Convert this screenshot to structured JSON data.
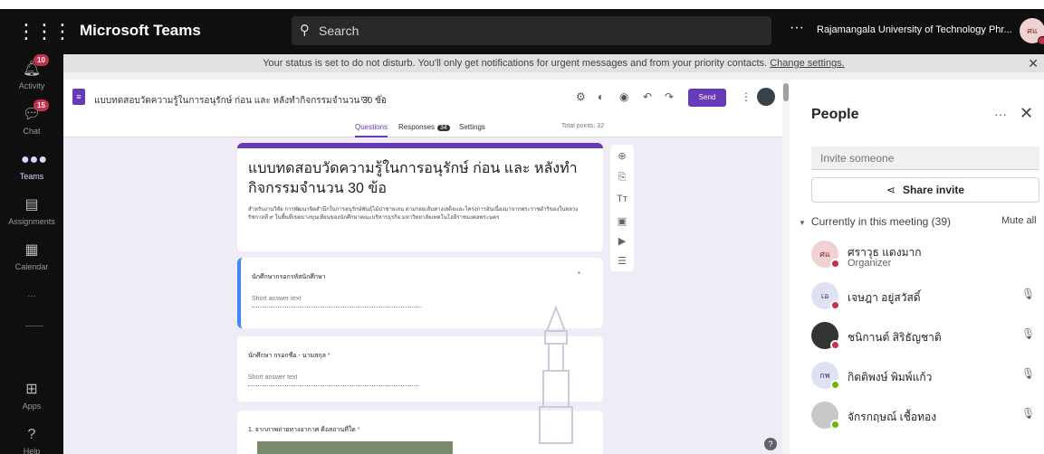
{
  "app": {
    "name": "Microsoft Teams",
    "search_placeholder": "Search",
    "more": "···",
    "org": "Rajamangala University of Technology Phr...",
    "avatar_initials": "ศแ"
  },
  "rail": [
    {
      "label": "Activity",
      "badge": "10",
      "icon": "bell-icon"
    },
    {
      "label": "Chat",
      "badge": "15",
      "icon": "chat-icon"
    },
    {
      "label": "Teams",
      "badge": "",
      "icon": "teams-icon"
    },
    {
      "label": "Assignments",
      "badge": "",
      "icon": "assignments-icon"
    },
    {
      "label": "Calendar",
      "badge": "",
      "icon": "calendar-icon"
    },
    {
      "label": "···",
      "badge": "",
      "icon": "more-icon"
    },
    {
      "label": "Apps",
      "badge": "",
      "icon": "apps-icon"
    },
    {
      "label": "Help",
      "badge": "",
      "icon": "help-icon"
    }
  ],
  "banner": {
    "text": "Your status is set to do not disturb. You'll only get notifications for urgent messages and from your priority contacts.",
    "link": "Change settings."
  },
  "form": {
    "title": "แบบทดสอบวัดความรู้ในการอนุรักษ์ ก่อน และ หลังทำกิจกรรมจำนวน 30 ข้อ",
    "send": "Send",
    "tabs": {
      "questions": "Questions",
      "responses": "Responses",
      "responses_count": "34",
      "settings": "Settings"
    },
    "total_points": "Total points: 32",
    "heading": "แบบทดสอบวัดความรู้ในการอนุรักษ์ ก่อน และ หลังทำกิจกรรมจำนวน 30 ข้อ",
    "description": "สำหรับงานวิจัย การพัฒนาจิตสำนึกในการอนุรักษ์พันธุ์ไม้ป่าชายเลน ตามรอยเส้นทางเสด็จและโครงการอันเนื่องมาจากพระราชดำริของในหลวงรัชกาลที่ ๙ ในพื้นที่เขตบางขุนเทียนของนักศึกษาคณะบริหารธุรกิจ มหาวิทยาลัยเทคโนโลยีราชมงคลพระนคร",
    "questions": [
      {
        "label": "นักศึกษากรอกรหัสนักศึกษา",
        "placeholder": "Short answer text"
      },
      {
        "label": "นักศึกษา กรอกชื่อ - นามสกุล",
        "placeholder": "Short answer text"
      },
      {
        "label": "1. จากภาพถ่ายทางอากาศ คือสถานที่ใด"
      }
    ],
    "required_mark": "*"
  },
  "people": {
    "title": "People",
    "invite_placeholder": "Invite someone",
    "share": "Share invite",
    "section": "Currently in this meeting (39)",
    "mute_all": "Mute all",
    "list": [
      {
        "initials": "ศแ",
        "name": "ศราวุธ แดงมาก",
        "role": "Organizer",
        "status": "dnd",
        "color": "#f0d2d2"
      },
      {
        "initials": "เอ",
        "name": "เจษฎา อยู่สวัสดิ์",
        "role": "",
        "status": "dnd",
        "color": "#dfe1f5"
      },
      {
        "initials": "",
        "name": "ชนิกานต์ สิริธัญชาติ",
        "role": "",
        "status": "dnd",
        "color": "#333333"
      },
      {
        "initials": "กพ",
        "name": "กิตติพงษ์ พิมพ์แก้ว",
        "role": "",
        "status": "ok",
        "color": "#dfe1f5"
      },
      {
        "initials": "",
        "name": "จักรกฤษณ์ เชื้อทอง",
        "role": "",
        "status": "ok",
        "color": "#c8c8c8"
      }
    ]
  }
}
